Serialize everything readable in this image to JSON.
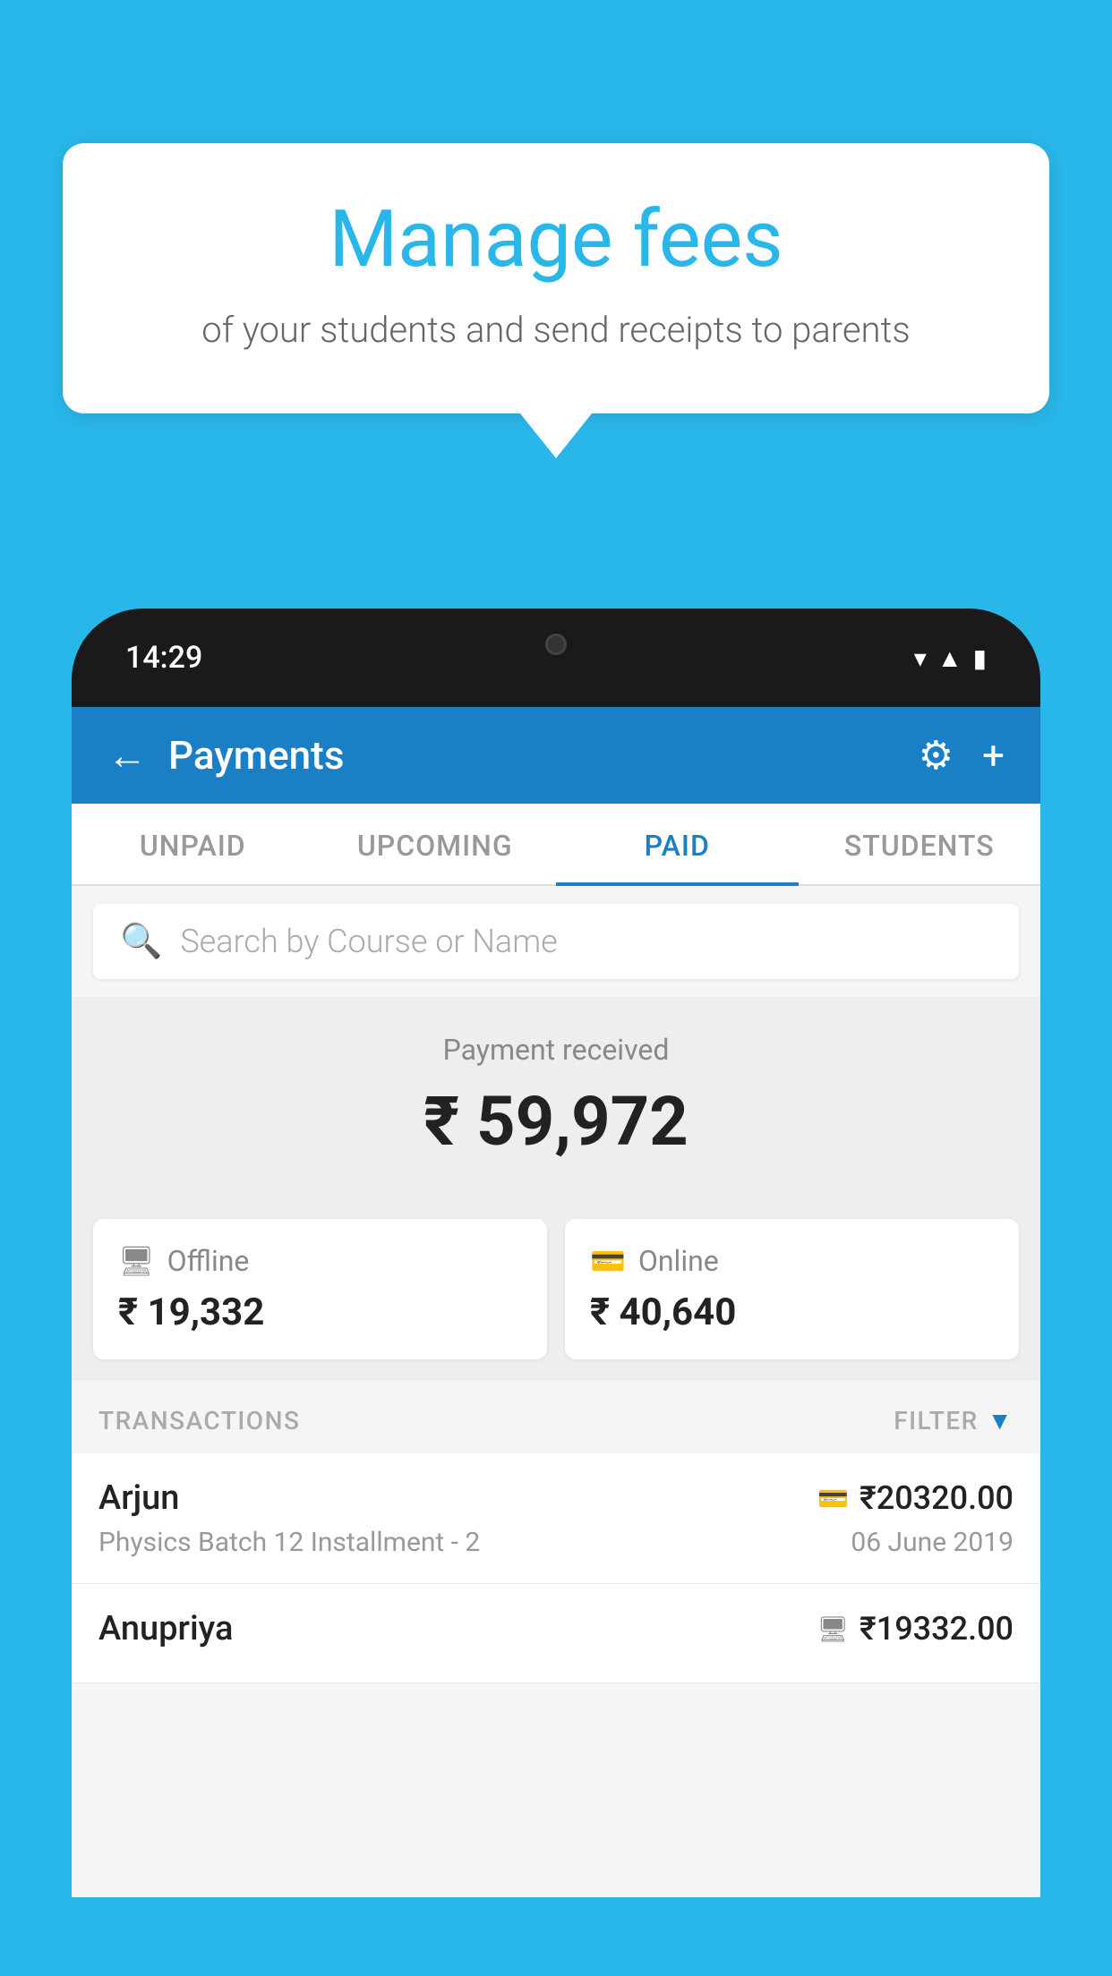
{
  "background_color": "#29b6e8",
  "speech_bubble": {
    "title": "Manage fees",
    "subtitle": "of your students and send receipts to parents"
  },
  "status_bar": {
    "time": "14:29",
    "wifi_icon": "wifi",
    "signal_icon": "signal",
    "battery_icon": "battery"
  },
  "header": {
    "title": "Payments",
    "back_label": "←",
    "settings_label": "⚙",
    "add_label": "+"
  },
  "tabs": [
    {
      "label": "UNPAID",
      "active": false
    },
    {
      "label": "UPCOMING",
      "active": false
    },
    {
      "label": "PAID",
      "active": true
    },
    {
      "label": "STUDENTS",
      "active": false
    }
  ],
  "search": {
    "placeholder": "Search by Course or Name"
  },
  "payment_summary": {
    "label": "Payment received",
    "amount": "₹ 59,972",
    "offline": {
      "label": "Offline",
      "amount": "₹ 19,332"
    },
    "online": {
      "label": "Online",
      "amount": "₹ 40,640"
    }
  },
  "transactions": {
    "header_label": "TRANSACTIONS",
    "filter_label": "FILTER",
    "items": [
      {
        "name": "Arjun",
        "desc": "Physics Batch 12 Installment - 2",
        "amount": "₹20320.00",
        "date": "06 June 2019",
        "payment_type": "online"
      },
      {
        "name": "Anupriya",
        "desc": "",
        "amount": "₹19332.00",
        "date": "",
        "payment_type": "offline"
      }
    ]
  }
}
